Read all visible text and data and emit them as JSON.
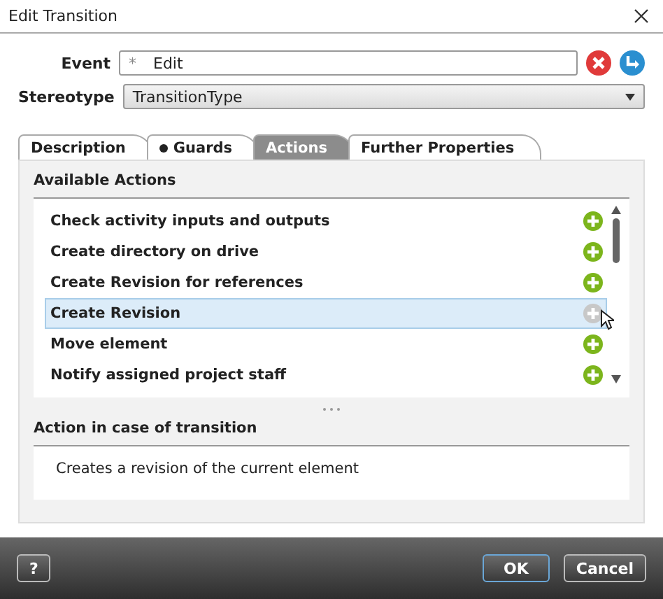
{
  "window": {
    "title": "Edit Transition"
  },
  "event": {
    "label": "Event",
    "marker": "*",
    "value": "Edit"
  },
  "stereotype": {
    "label": "Stereotype",
    "value": "TransitionType"
  },
  "tabs": [
    {
      "label": "Description",
      "selected": false,
      "bullet": false
    },
    {
      "label": "Guards",
      "selected": false,
      "bullet": true
    },
    {
      "label": "Actions",
      "selected": true,
      "bullet": false
    },
    {
      "label": "Further Properties",
      "selected": false,
      "bullet": false
    }
  ],
  "available_actions": {
    "title": "Available Actions",
    "items": [
      {
        "label": "Check activity inputs and outputs",
        "selected": false
      },
      {
        "label": "Create directory on drive",
        "selected": false
      },
      {
        "label": "Create Revision for references",
        "selected": false
      },
      {
        "label": "Create Revision",
        "selected": true
      },
      {
        "label": "Move element",
        "selected": false
      },
      {
        "label": "Notify assigned project staff",
        "selected": false
      }
    ]
  },
  "action_description": {
    "title": "Action in case of transition",
    "text": "Creates a revision of the current element"
  },
  "footer": {
    "help": "?",
    "buttons": [
      "OK",
      "Cancel"
    ]
  }
}
